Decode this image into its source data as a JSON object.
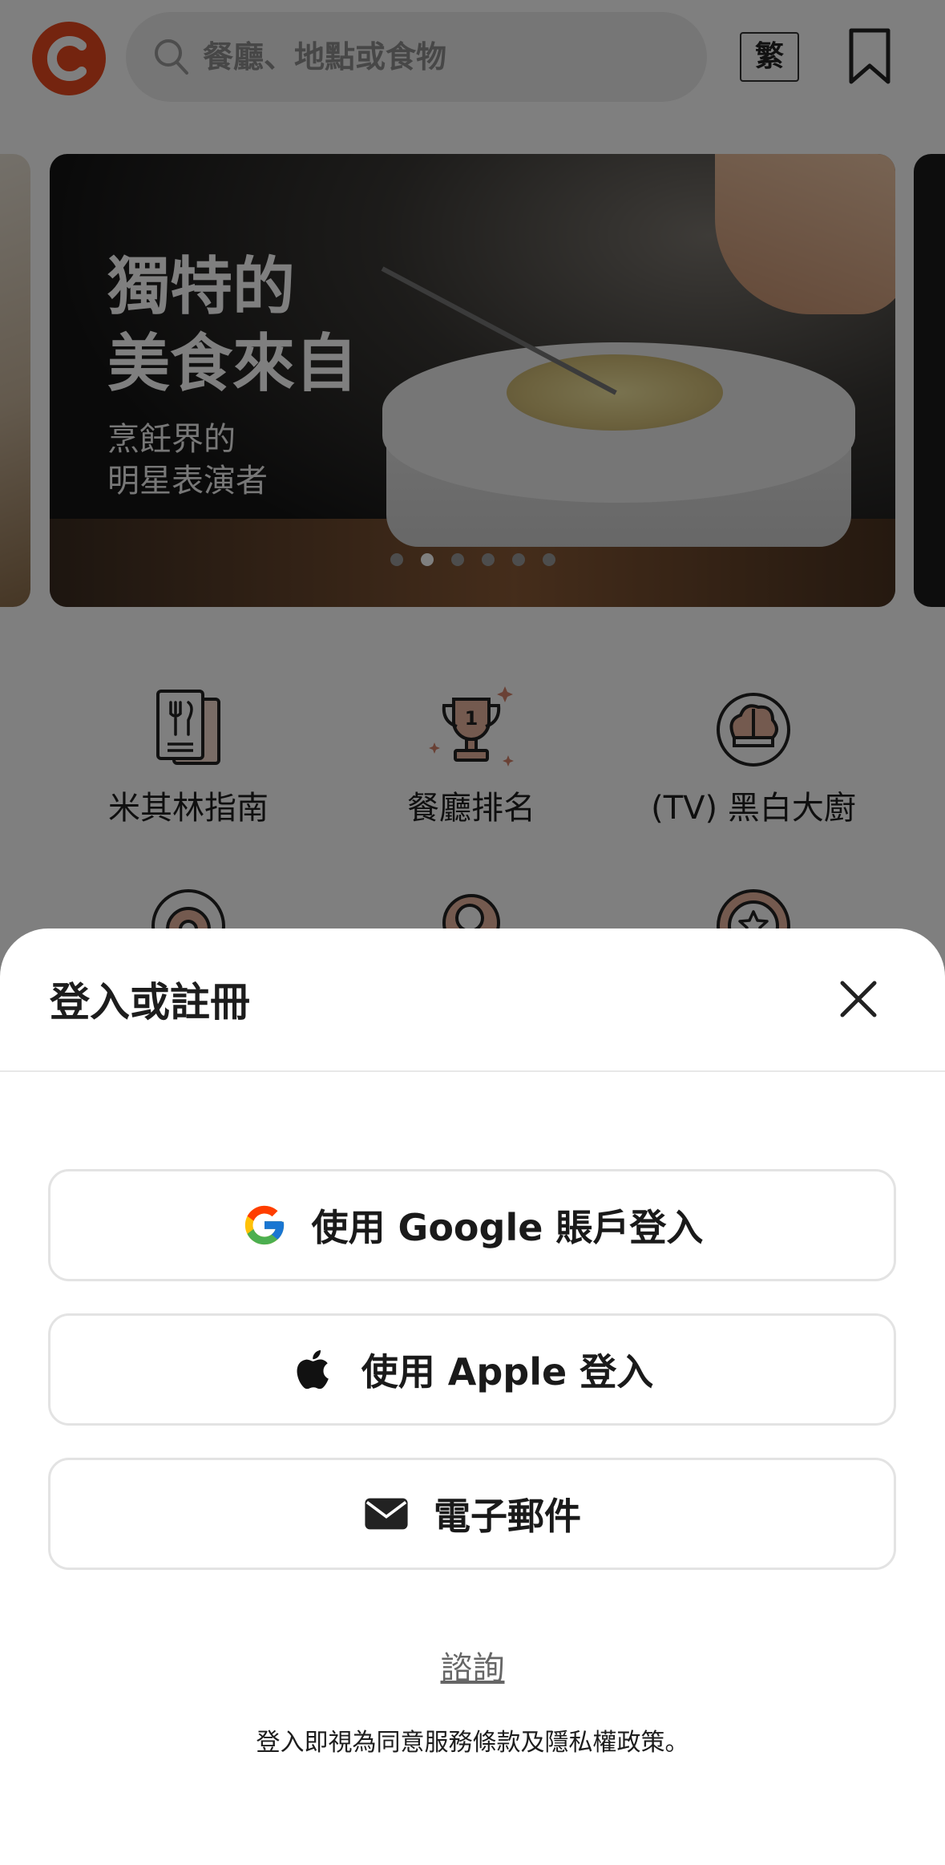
{
  "header": {
    "search_placeholder": "餐廳、地點或食物",
    "lang_label": "繁"
  },
  "banner": {
    "title_line1": "獨特的",
    "title_line2": "美食來自",
    "sub_line1": "烹飪界的",
    "sub_line2": "明星表演者",
    "slide_count": 6,
    "active_slide": 2
  },
  "categories": [
    {
      "label": "米其林指南",
      "icon": "michelin-guide-icon"
    },
    {
      "label": "餐廳排名",
      "icon": "trophy-icon"
    },
    {
      "label": "(TV) 黑白大廚",
      "icon": "chef-hat-icon"
    }
  ],
  "login_sheet": {
    "title": "登入或註冊",
    "google_label": "使用 Google 賬戶登入",
    "apple_label": "使用 Apple 登入",
    "email_label": "電子郵件",
    "inquiry_label": "諮詢",
    "terms_text": "登入即視為同意服務條款及隱私權政策。"
  },
  "colors": {
    "brand": "#e8481f",
    "accent_icon": "#c9775a",
    "overlay": "rgba(0,0,0,0.5)"
  }
}
